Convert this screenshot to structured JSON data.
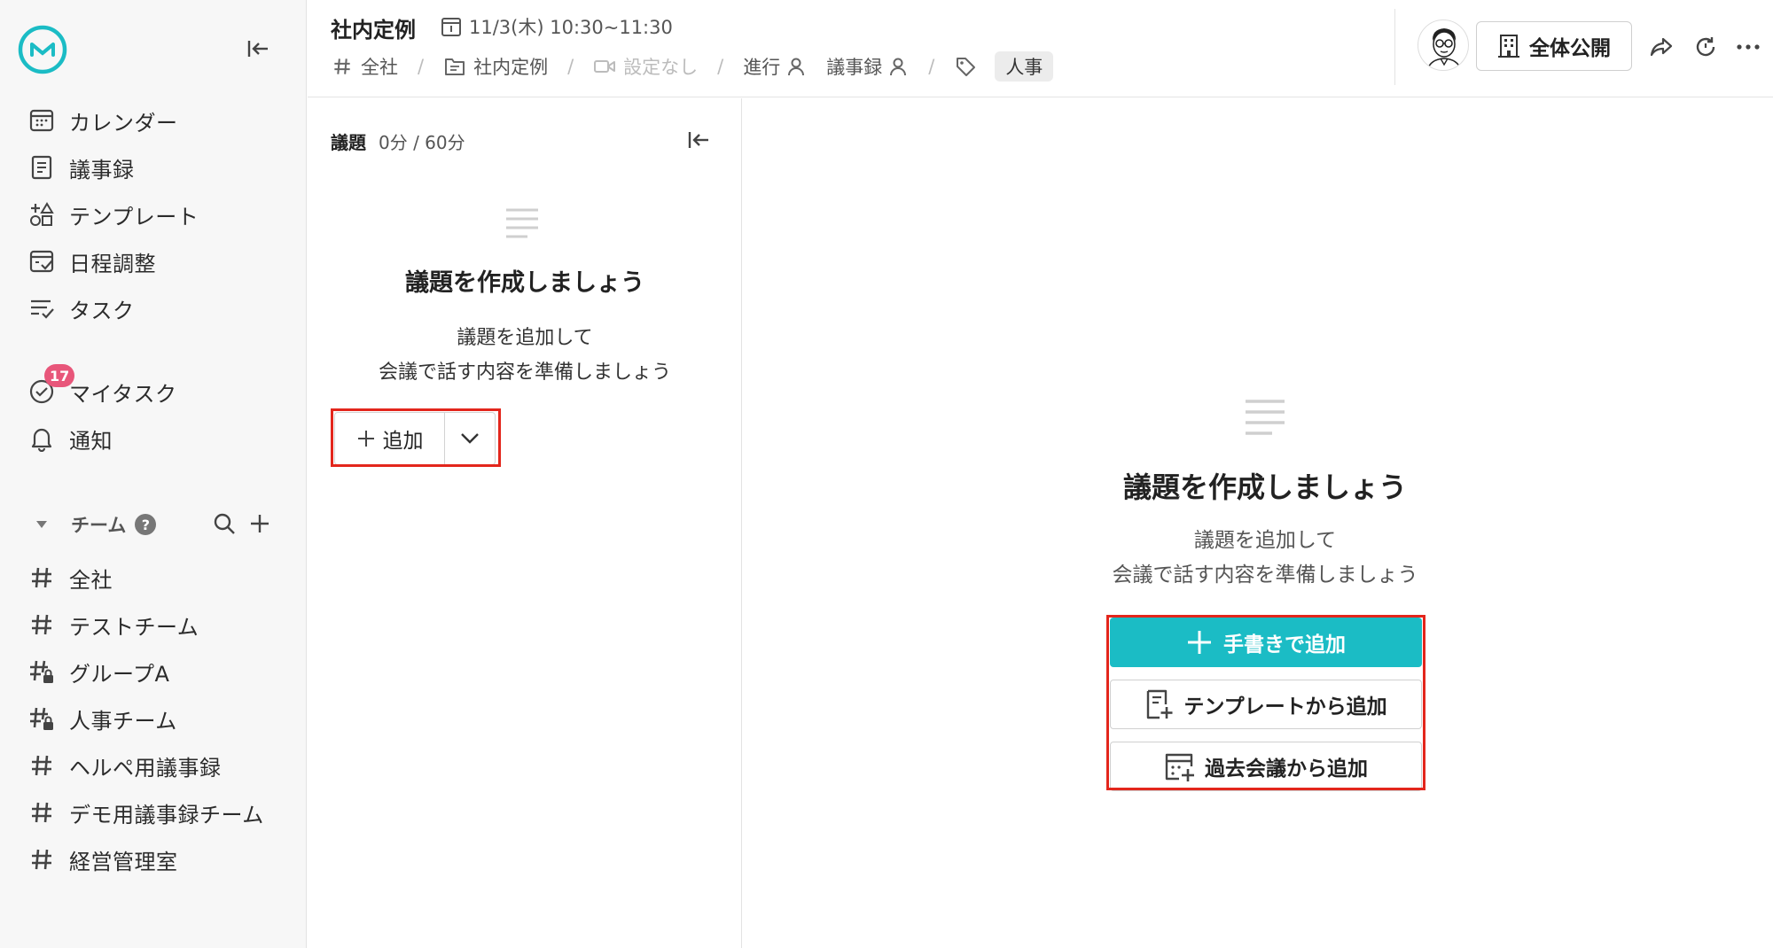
{
  "colors": {
    "brand": "#1bbcc5",
    "badge": "#e8567a",
    "highlight": "#e3261c",
    "sidebar_bg": "#f7f7f7"
  },
  "sidebar": {
    "logo_icon": "brand-logo-icon",
    "collapse_icon": "collapse-left-icon",
    "nav": [
      {
        "label": "カレンダー",
        "icon": "calendar-icon"
      },
      {
        "label": "議事録",
        "icon": "document-icon"
      },
      {
        "label": "テンプレート",
        "icon": "template-icon"
      },
      {
        "label": "日程調整",
        "icon": "schedule-icon"
      },
      {
        "label": "タスク",
        "icon": "task-list-icon"
      }
    ],
    "personal": [
      {
        "label": "マイタスク",
        "icon": "check-circle-icon",
        "badge": "17"
      },
      {
        "label": "通知",
        "icon": "bell-icon"
      }
    ],
    "team_header": {
      "label": "チーム",
      "help": "?"
    },
    "teams": [
      {
        "label": "全社",
        "icon": "hash-icon"
      },
      {
        "label": "テストチーム",
        "icon": "hash-icon"
      },
      {
        "label": "グループA",
        "icon": "hash-lock-icon"
      },
      {
        "label": "人事チーム",
        "icon": "hash-lock-icon"
      },
      {
        "label": "ヘルペ用議事録",
        "icon": "hash-icon"
      },
      {
        "label": "デモ用議事録チーム",
        "icon": "hash-icon"
      },
      {
        "label": "経営管理室",
        "icon": "hash-icon"
      }
    ]
  },
  "header": {
    "title": "社内定例",
    "datetime": "11/3(木) 10:30~11:30",
    "crumbs": {
      "team": "全社",
      "folder": "社内定例",
      "video": "設定なし",
      "facilitator": "進行",
      "minutes": "議事録",
      "tag": "人事"
    },
    "public_label": "全体公開"
  },
  "agenda": {
    "title": "議題",
    "time": "0分 / 60分",
    "empty_title": "議題を作成しましょう",
    "empty_line1": "議題を追加して",
    "empty_line2": "会議で話す内容を準備しましょう",
    "add_label": "追加"
  },
  "main": {
    "empty_title": "議題を作成しましょう",
    "empty_line1": "議題を追加して",
    "empty_line2": "会議で話す内容を準備しましょう",
    "handwrite_label": "手書きで追加",
    "template_label": "テンプレートから追加",
    "past_label": "過去会議から追加"
  }
}
